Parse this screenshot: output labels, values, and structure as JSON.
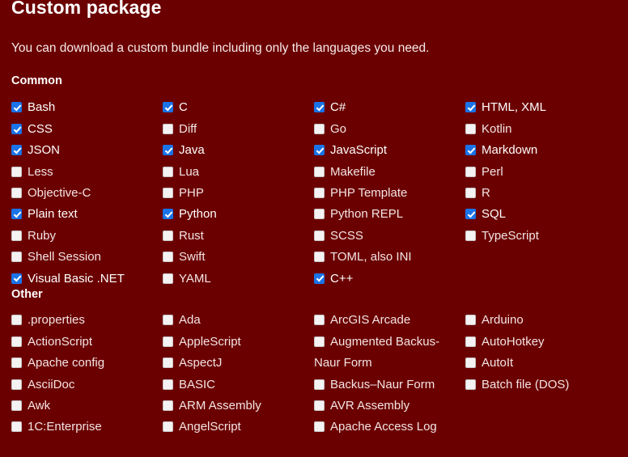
{
  "page": {
    "title": "Custom package",
    "intro": "You can download a custom bundle including only the languages you need."
  },
  "colors": {
    "background": "#6b0000",
    "text": "#f3e4e4",
    "heading": "#ffffff",
    "checkbox_checked": "#1a73e8",
    "checkbox_unchecked": "#f4f2f2"
  },
  "sections": [
    {
      "id": "common",
      "title": "Common",
      "columns": [
        [
          {
            "label": "Bash",
            "checked": true
          },
          {
            "label": "CSS",
            "checked": true
          },
          {
            "label": "JSON",
            "checked": true
          },
          {
            "label": "Less",
            "checked": false
          },
          {
            "label": "Objective-C",
            "checked": false
          },
          {
            "label": "Plain text",
            "checked": true
          },
          {
            "label": "Ruby",
            "checked": false
          },
          {
            "label": "Shell Session",
            "checked": false
          },
          {
            "label": "Visual Basic .NET",
            "checked": true
          }
        ],
        [
          {
            "label": "C",
            "checked": true
          },
          {
            "label": "Diff",
            "checked": false
          },
          {
            "label": "Java",
            "checked": true
          },
          {
            "label": "Lua",
            "checked": false
          },
          {
            "label": "PHP",
            "checked": false
          },
          {
            "label": "Python",
            "checked": true
          },
          {
            "label": "Rust",
            "checked": false
          },
          {
            "label": "Swift",
            "checked": false
          },
          {
            "label": "YAML",
            "checked": false
          }
        ],
        [
          {
            "label": "C#",
            "checked": true
          },
          {
            "label": "Go",
            "checked": false
          },
          {
            "label": "JavaScript",
            "checked": true
          },
          {
            "label": "Makefile",
            "checked": false
          },
          {
            "label": "PHP Template",
            "checked": false
          },
          {
            "label": "Python REPL",
            "checked": false
          },
          {
            "label": "SCSS",
            "checked": false
          },
          {
            "label": "TOML, also INI",
            "checked": false
          }
        ],
        [
          {
            "label": "C++",
            "checked": true
          },
          {
            "label": "HTML, XML",
            "checked": true
          },
          {
            "label": "Kotlin",
            "checked": false
          },
          {
            "label": "Markdown",
            "checked": true
          },
          {
            "label": "Perl",
            "checked": false
          },
          {
            "label": "R",
            "checked": false
          },
          {
            "label": "SQL",
            "checked": true
          },
          {
            "label": "TypeScript",
            "checked": false
          }
        ]
      ]
    },
    {
      "id": "other",
      "title": "Other",
      "columns": [
        [
          {
            "label": ".properties",
            "checked": false
          },
          {
            "label": "ActionScript",
            "checked": false
          },
          {
            "label": "Apache config",
            "checked": false
          },
          {
            "label": "AsciiDoc",
            "checked": false
          },
          {
            "label": "Awk",
            "checked": false
          }
        ],
        [
          {
            "label": "1C:Enterprise",
            "checked": false
          },
          {
            "label": "Ada",
            "checked": false
          },
          {
            "label": "AppleScript",
            "checked": false
          },
          {
            "label": "AspectJ",
            "checked": false
          },
          {
            "label": "BASIC",
            "checked": false
          }
        ],
        [
          {
            "label": "ARM Assembly",
            "checked": false
          },
          {
            "label": "AngelScript",
            "checked": false
          },
          {
            "label": "ArcGIS Arcade",
            "checked": false
          },
          {
            "label": "Augmented Backus-Naur Form",
            "checked": false
          },
          {
            "label": "Backus–Naur Form",
            "checked": false
          }
        ],
        [
          {
            "label": "AVR Assembly",
            "checked": false
          },
          {
            "label": "Apache Access Log",
            "checked": false
          },
          {
            "label": "Arduino",
            "checked": false
          },
          {
            "label": "AutoHotkey",
            "checked": false
          },
          {
            "label": "AutoIt",
            "checked": false
          },
          {
            "label": "Batch file (DOS)",
            "checked": false
          }
        ]
      ]
    }
  ]
}
